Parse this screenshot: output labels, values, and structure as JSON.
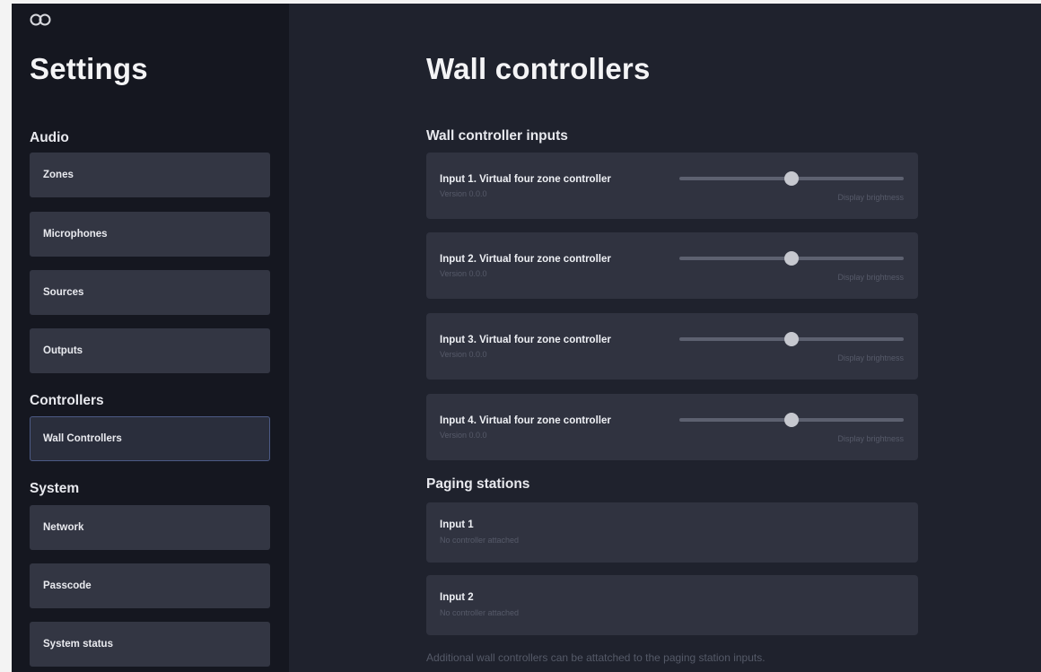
{
  "sidebar": {
    "title": "Settings",
    "groups": [
      {
        "label": "Audio",
        "items": [
          "Zones",
          "Microphones",
          "Sources",
          "Outputs"
        ]
      },
      {
        "label": "Controllers",
        "items": [
          "Wall Controllers"
        ]
      },
      {
        "label": "System",
        "items": [
          "Network",
          "Passcode",
          "System status"
        ]
      }
    ],
    "active_item": "Wall Controllers"
  },
  "main": {
    "title": "Wall controllers",
    "wall_inputs": {
      "heading": "Wall controller inputs",
      "items": [
        {
          "name": "Input 1. Virtual four zone controller",
          "version": "Version 0.0.0",
          "slider_label": "Display brightness",
          "brightness": 0.5
        },
        {
          "name": "Input 2. Virtual four zone controller",
          "version": "Version 0.0.0",
          "slider_label": "Display brightness",
          "brightness": 0.5
        },
        {
          "name": "Input 3. Virtual four zone controller",
          "version": "Version 0.0.0",
          "slider_label": "Display brightness",
          "brightness": 0.5
        },
        {
          "name": "Input 4. Virtual four zone controller",
          "version": "Version 0.0.0",
          "slider_label": "Display brightness",
          "brightness": 0.5
        }
      ]
    },
    "paging": {
      "heading": "Paging stations",
      "items": [
        {
          "name": "Input 1",
          "status": "No controller attached"
        },
        {
          "name": "Input 2",
          "status": "No controller attached"
        }
      ],
      "footnote": "Additional wall controllers can be attatched to the paging station inputs."
    }
  },
  "colors": {
    "background": "#1f222d",
    "sidebar": "#151720",
    "card": "#303340",
    "active_border": "#4c5a85"
  },
  "icons": {
    "logo": "logo-icon"
  }
}
